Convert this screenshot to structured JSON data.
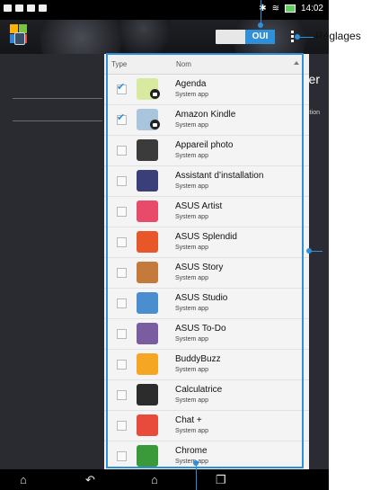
{
  "status_bar": {
    "time": "14:02"
  },
  "action_bar": {
    "toggle_label": "OUI"
  },
  "annotation": {
    "settings_label": "Réglages"
  },
  "sidebar": {
    "title": "App Locker",
    "item": "File Protection"
  },
  "table": {
    "col_type": "Type",
    "col_name": "Nom",
    "rows": [
      {
        "name": "Agenda",
        "sub": "System app",
        "checked": true,
        "locked": true,
        "icon": "agenda-icon",
        "color": "#d8eaa0"
      },
      {
        "name": "Amazon Kindle",
        "sub": "System app",
        "checked": true,
        "locked": true,
        "icon": "kindle-icon",
        "color": "#a9c4dd"
      },
      {
        "name": "Appareil photo",
        "sub": "System app",
        "checked": false,
        "locked": false,
        "icon": "camera-icon",
        "color": "#3b3b3b"
      },
      {
        "name": "Assistant d’installation",
        "sub": "System app",
        "checked": false,
        "locked": false,
        "icon": "setup-wizard-icon",
        "color": "#3a3f7a"
      },
      {
        "name": "ASUS Artist",
        "sub": "System app",
        "checked": false,
        "locked": false,
        "icon": "artist-icon",
        "color": "#e84a6a"
      },
      {
        "name": "ASUS Splendid",
        "sub": "System app",
        "checked": false,
        "locked": false,
        "icon": "splendid-icon",
        "color": "#e8572a"
      },
      {
        "name": "ASUS Story",
        "sub": "System app",
        "checked": false,
        "locked": false,
        "icon": "story-icon",
        "color": "#c47a3a"
      },
      {
        "name": "ASUS Studio",
        "sub": "System app",
        "checked": false,
        "locked": false,
        "icon": "studio-icon",
        "color": "#4a8ed0"
      },
      {
        "name": "ASUS To-Do",
        "sub": "System app",
        "checked": false,
        "locked": false,
        "icon": "todo-icon",
        "color": "#7a5ca0"
      },
      {
        "name": "BuddyBuzz",
        "sub": "System app",
        "checked": false,
        "locked": false,
        "icon": "buddybuzz-icon",
        "color": "#f5a623"
      },
      {
        "name": "Calculatrice",
        "sub": "System app",
        "checked": false,
        "locked": false,
        "icon": "calculator-icon",
        "color": "#2c2c2c"
      },
      {
        "name": "Chat +",
        "sub": "System app",
        "checked": false,
        "locked": false,
        "icon": "chat-plus-icon",
        "color": "#e84a3c"
      },
      {
        "name": "Chrome",
        "sub": "System app",
        "checked": false,
        "locked": false,
        "icon": "chrome-icon",
        "color": "#3a9a3a"
      }
    ]
  },
  "colors": {
    "accent": "#2f8fd8"
  }
}
